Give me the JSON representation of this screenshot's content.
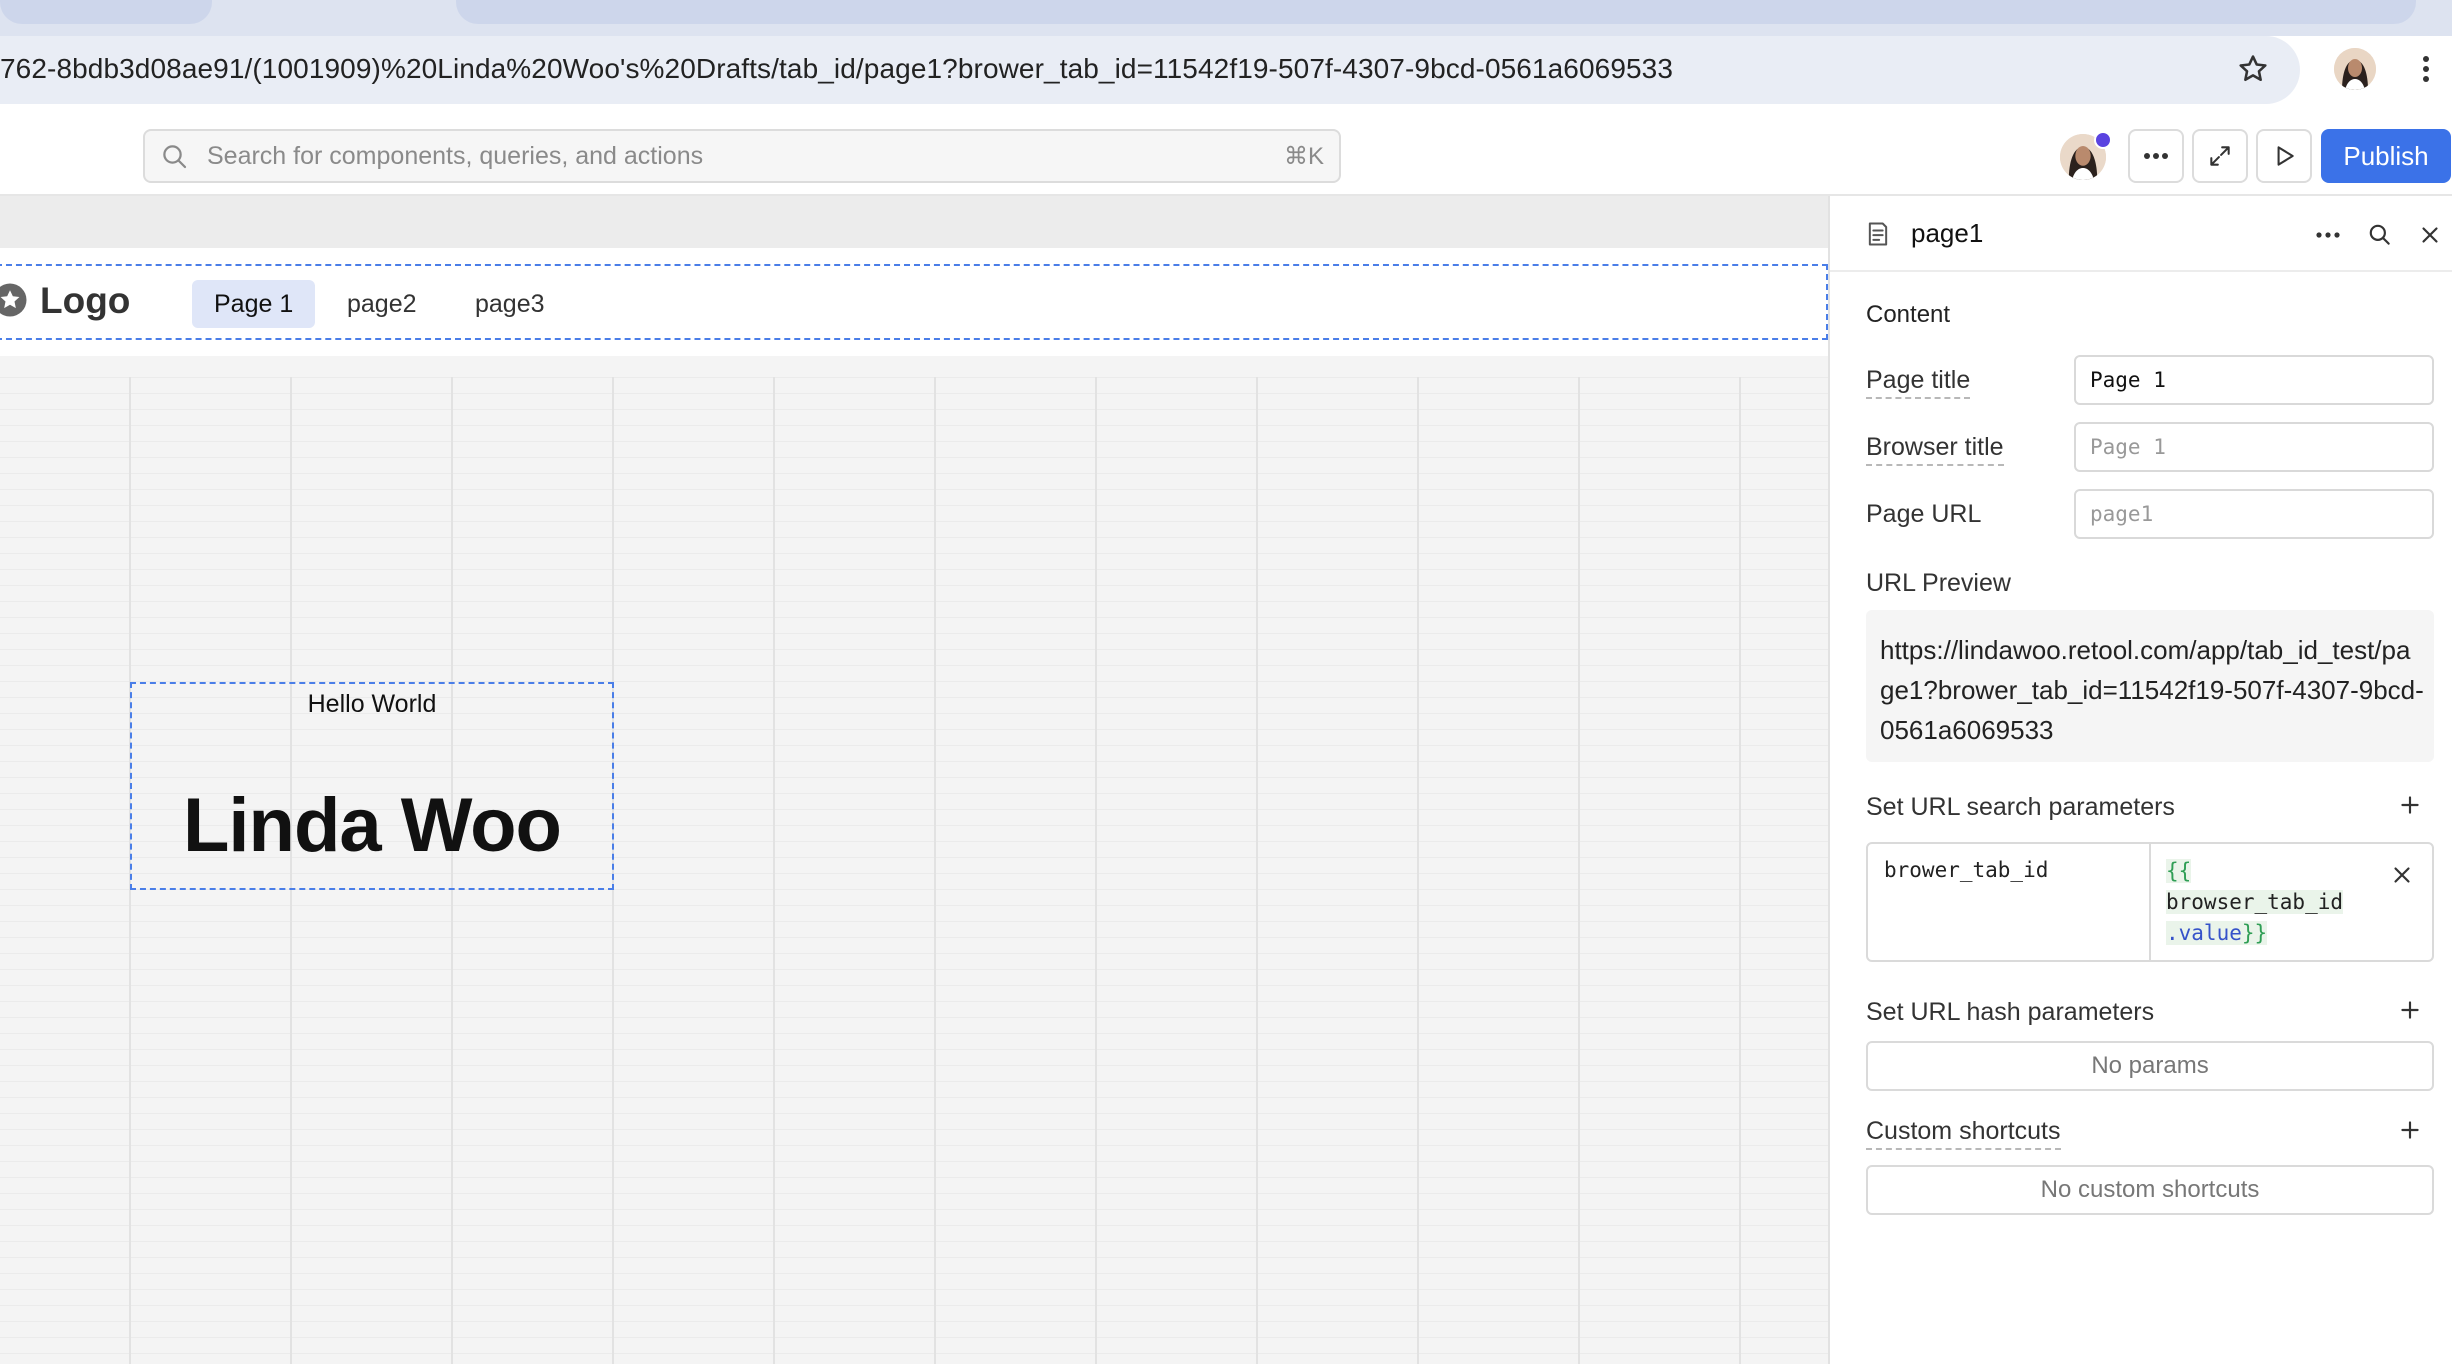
{
  "browser": {
    "url": "762-8bdb3d08ae91/(1001909)%20Linda%20Woo's%20Drafts/tab_id/page1?brower_tab_id=11542f19-507f-4307-9bcd-0561a6069533"
  },
  "toolbar": {
    "search_placeholder": "Search for components, queries, and actions",
    "search_shortcut": "⌘K",
    "publish_label": "Publish"
  },
  "canvas": {
    "logo": "Logo",
    "nav_tabs": [
      "Page 1",
      "page2",
      "page3"
    ],
    "text_small": "Hello World",
    "text_large": "Linda Woo"
  },
  "inspector": {
    "title": "page1",
    "content_label": "Content",
    "page_title_label": "Page title",
    "page_title_value": "Page 1",
    "browser_title_label": "Browser title",
    "browser_title_placeholder": "Page 1",
    "page_url_label": "Page URL",
    "page_url_placeholder": "page1",
    "url_preview_label": "URL Preview",
    "url_preview": "https://lindawoo.retool.com/app/tab_id_test/page1?brower_tab_id=11542f19-507f-4307-9bcd-0561a6069533",
    "search_params_label": "Set URL search parameters",
    "search_param": {
      "key": "brower_tab_id",
      "value_open": "{{",
      "value_id": "browser_tab_id",
      "value_prop": ".value",
      "value_close": "}}"
    },
    "hash_params_label": "Set URL hash parameters",
    "hash_params_empty": "No params",
    "shortcuts_label": "Custom shortcuts",
    "shortcuts_empty": "No custom shortcuts"
  },
  "colors": {
    "accent": "#3b72e8",
    "selection_outline": "#4a7ee8",
    "active_tab_bg": "#dfe6f8"
  }
}
